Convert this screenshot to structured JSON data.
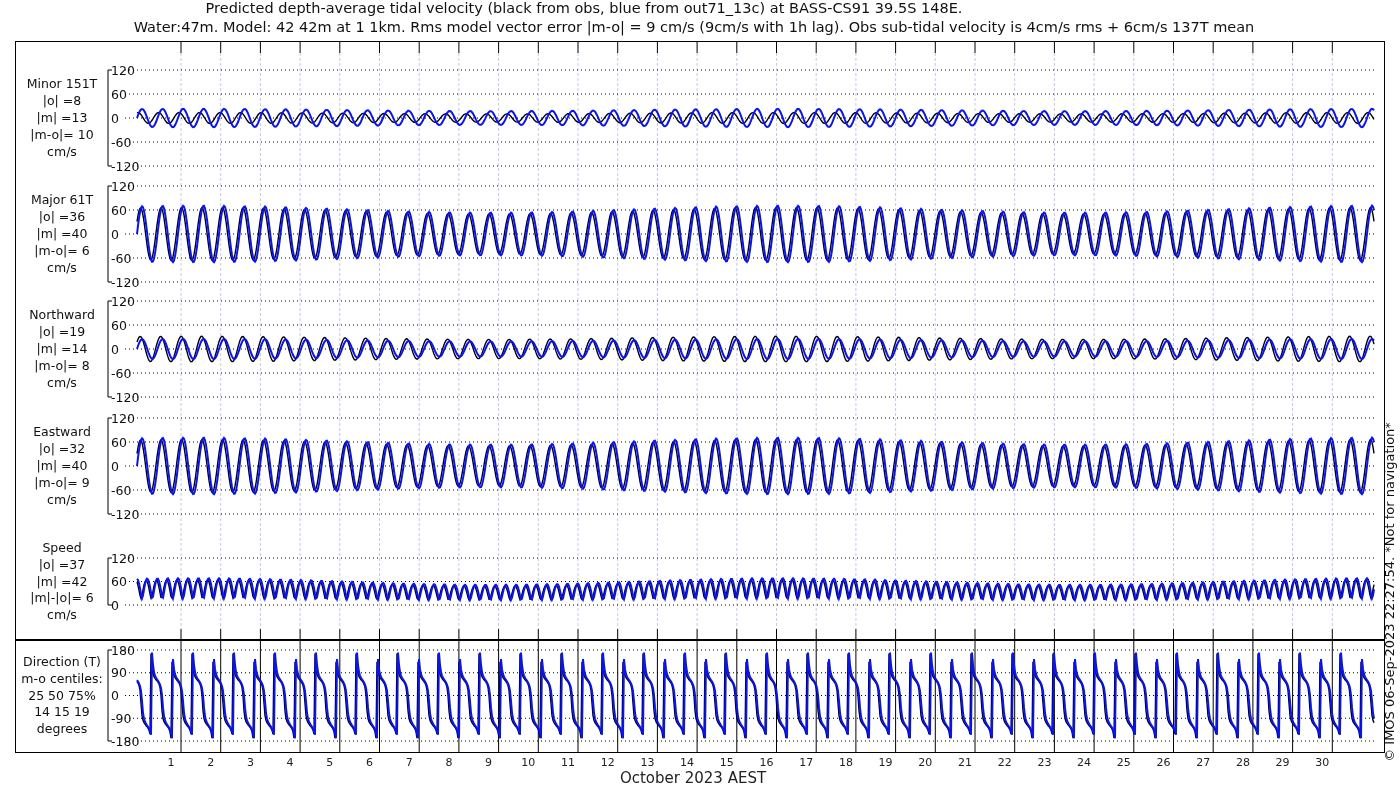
{
  "title": {
    "line_1": "Predicted depth-average tidal velocity (black from obs, blue from out71_13c) at BASS-CS91 39.5S 148E.",
    "line_2": "Water:47m. Model: 42 42m at 1 1km. Rms model vector error |m-o| = 9 cm/s (9cm/s with 1h lag). Obs sub-tidal velocity is 4cm/s rms + 6cm/s 137T mean"
  },
  "panels": [
    {
      "kind": "velocity",
      "label_lines": [
        "Minor 151T",
        "|o| =8",
        "|m| =13",
        "|m-o|= 10",
        "cm/s"
      ],
      "yticks": [
        "120",
        "60",
        "0",
        "-60",
        "-120"
      ]
    },
    {
      "kind": "velocity",
      "label_lines": [
        "Major 61T",
        "|o| =36",
        "|m| =40",
        "|m-o|= 6",
        "cm/s"
      ],
      "yticks": [
        "120",
        "60",
        "0",
        "-60",
        "-120"
      ]
    },
    {
      "kind": "velocity",
      "label_lines": [
        "Northward",
        "|o| =19",
        "|m| =14",
        "|m-o|= 8",
        "cm/s"
      ],
      "yticks": [
        "120",
        "60",
        "0",
        "-60",
        "-120"
      ]
    },
    {
      "kind": "velocity",
      "label_lines": [
        "Eastward",
        "|o| =32",
        "|m| =40",
        "|m-o|= 9",
        "cm/s"
      ],
      "yticks": [
        "120",
        "60",
        "0",
        "-60",
        "-120"
      ]
    },
    {
      "kind": "speed",
      "label_lines": [
        "Speed",
        "|o| =37",
        "|m| =42",
        "|m|-|o|= 6",
        "cm/s"
      ],
      "yticks": [
        "120",
        "60",
        "0"
      ]
    },
    {
      "kind": "direction",
      "label_lines": [
        "Direction (T)",
        "m-o centiles:",
        "25  50  75%",
        "14  15  19",
        "degrees"
      ],
      "yticks": [
        "180",
        "90",
        "0",
        "-90",
        "-180"
      ]
    }
  ],
  "x_axis": {
    "day_labels": [
      "1",
      "2",
      "3",
      "4",
      "5",
      "6",
      "7",
      "8",
      "9",
      "10",
      "11",
      "12",
      "13",
      "14",
      "15",
      "16",
      "17",
      "18",
      "19",
      "20",
      "21",
      "22",
      "23",
      "24",
      "25",
      "26",
      "27",
      "28",
      "29",
      "30"
    ],
    "label": "October 2023 AEST"
  },
  "credit": "© IMOS 06-Sep-2023 22:27:54. *Not for navigation*"
}
